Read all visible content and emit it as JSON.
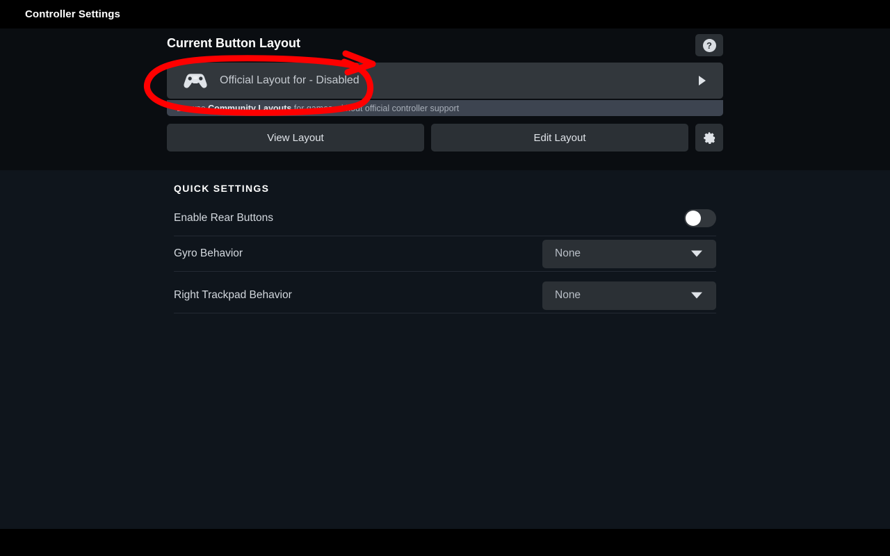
{
  "window": {
    "title": "Controller Settings"
  },
  "colors": {
    "background_top": "#0a0d11",
    "background_main": "#0f151c",
    "panel": "#2b3035",
    "row": "#32373c",
    "banner": "#3d4450",
    "annotation_red": "#ff0000",
    "text_primary": "#ffffff",
    "text_secondary": "#c6cbd1"
  },
  "layout_section": {
    "heading": "Current Button Layout",
    "help_button": {
      "icon": "question-mark-icon",
      "label": "?"
    },
    "current_layout": {
      "icon": "gamepad-icon",
      "name": "Official Layout for - Disabled",
      "chevron": "chevron-right-icon"
    },
    "community_banner": {
      "prefix": "Browse ",
      "link": "Community Layouts",
      "suffix": " for games without official controller support"
    },
    "buttons": {
      "view_layout": "View Layout",
      "edit_layout": "Edit Layout",
      "settings_icon": "gear-icon"
    }
  },
  "quick_settings": {
    "heading": "QUICK SETTINGS",
    "rows": [
      {
        "label": "Enable Rear Buttons",
        "control": "toggle",
        "value": "off"
      },
      {
        "label": "Gyro Behavior",
        "control": "select",
        "value": "None"
      },
      {
        "label": "Right Trackpad Behavior",
        "control": "select",
        "value": "None"
      }
    ]
  },
  "annotation": {
    "type": "hand-drawn-circle-with-arrow",
    "color": "#ff0000",
    "target": "Official Layout for - Disabled"
  }
}
